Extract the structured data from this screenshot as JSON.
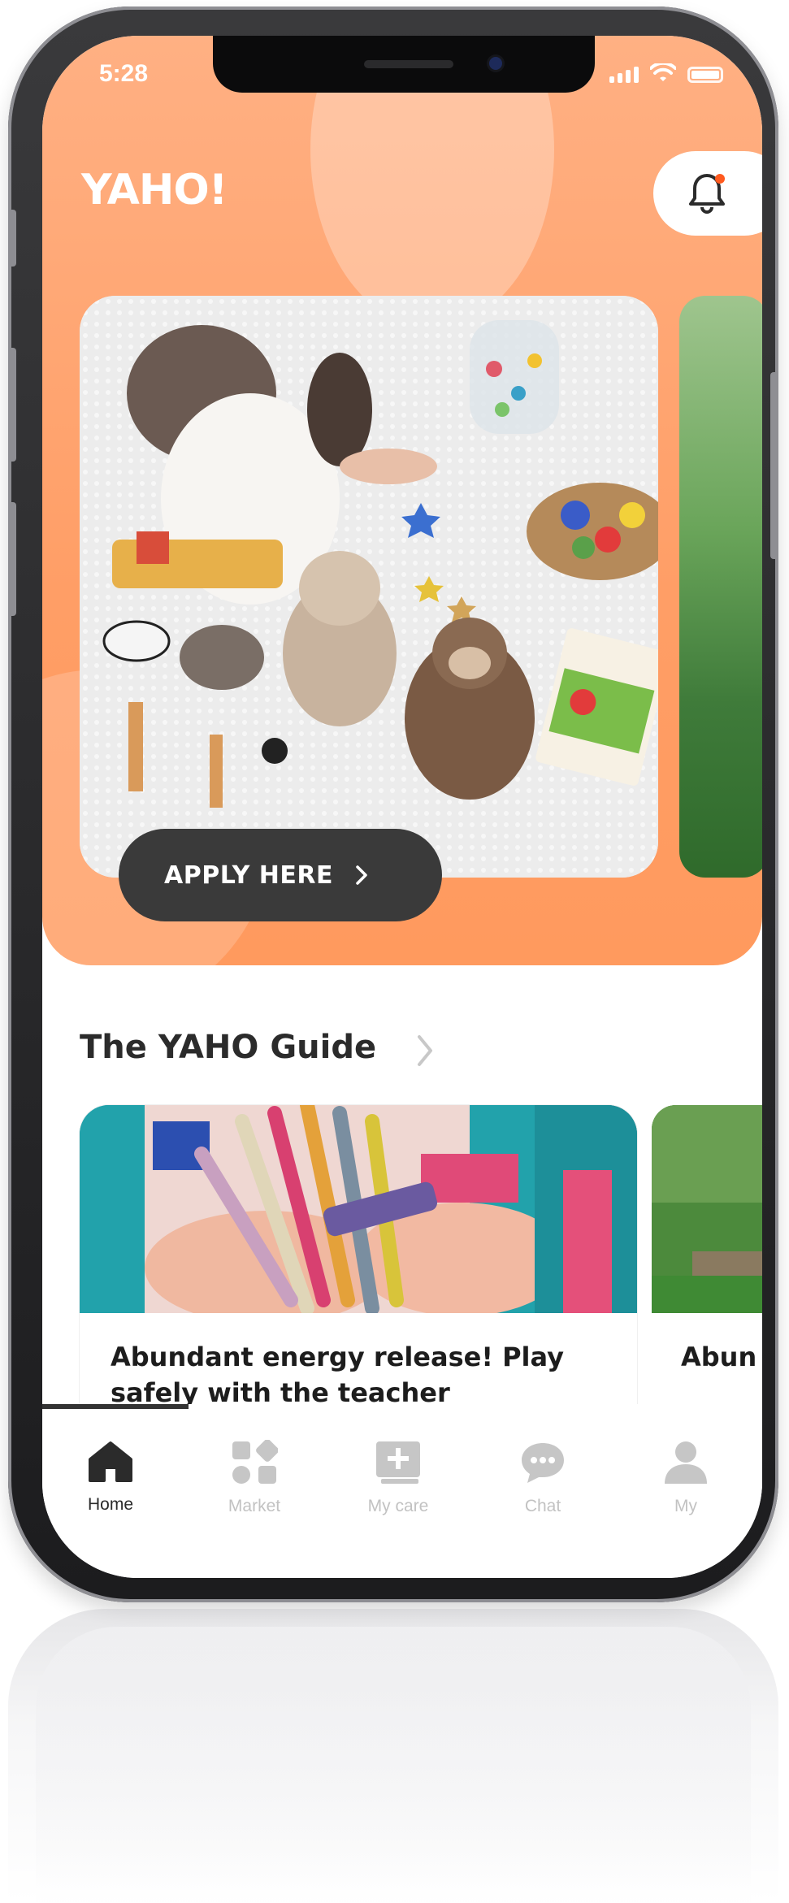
{
  "status_bar": {
    "time": "5:28"
  },
  "header": {
    "logo": "YAHO!",
    "notification_icon": "bell-icon",
    "notification_dot_color": "#ff5a1f"
  },
  "banner": {
    "cta_label": "APPLY HERE",
    "cta_icon": "chevron-right-icon"
  },
  "guide": {
    "title": "The YAHO Guide",
    "cards": [
      {
        "title": "Abundant energy release! Play safely with the teacher"
      },
      {
        "title": "Abun safely"
      }
    ]
  },
  "tabs": [
    {
      "label": "Home",
      "icon": "home-icon",
      "active": true
    },
    {
      "label": "Market",
      "icon": "market-icon",
      "active": false
    },
    {
      "label": "My care",
      "icon": "my-care-icon",
      "active": false
    },
    {
      "label": "Chat",
      "icon": "chat-icon",
      "active": false
    },
    {
      "label": "My",
      "icon": "profile-icon",
      "active": false
    }
  ],
  "colors": {
    "brand_orange": "#ff9e66",
    "tab_active": "#2b2b2b",
    "tab_inactive": "#c2c2c2"
  }
}
